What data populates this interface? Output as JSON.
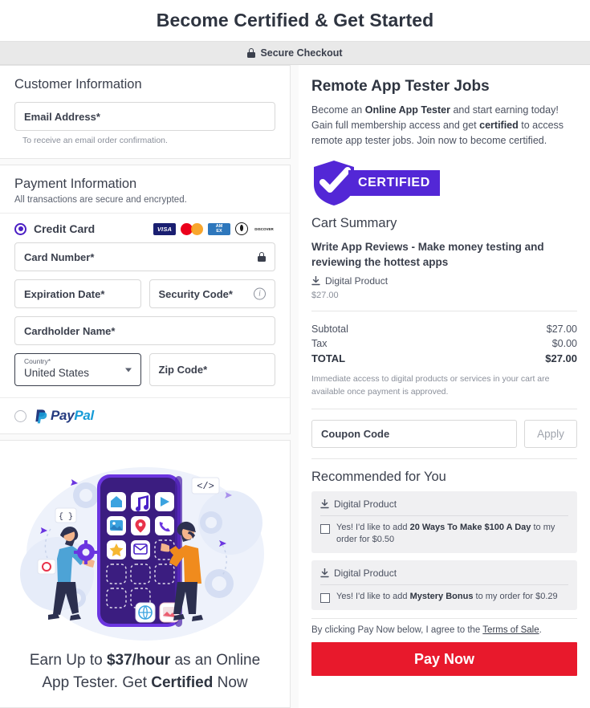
{
  "header": {
    "title": "Become Certified & Get Started",
    "secure_label": "Secure Checkout",
    "lock_icon": "lock-icon"
  },
  "customer": {
    "section_title": "Customer Information",
    "email_placeholder": "Email Address*",
    "email_value": "",
    "email_note": "To receive an email order confirmation."
  },
  "payment": {
    "section_title": "Payment Information",
    "section_subtitle": "All transactions are secure and encrypted.",
    "credit_card_label": "Credit Card",
    "credit_card_selected": true,
    "brands": [
      {
        "name": "visa-logo",
        "text": "VISA"
      },
      {
        "name": "mastercard-logo",
        "text": ""
      },
      {
        "name": "amex-logo",
        "text1": "AM",
        "text2": "EX"
      },
      {
        "name": "diners-club-logo",
        "text": ""
      },
      {
        "name": "discover-logo",
        "text": "DISCOVER"
      }
    ],
    "card_number_placeholder": "Card Number*",
    "card_number_value": "",
    "expiration_placeholder": "Expiration Date*",
    "expiration_value": "",
    "security_code_placeholder": "Security Code*",
    "security_code_value": "",
    "cardholder_placeholder": "Cardholder Name*",
    "cardholder_value": "",
    "country_label": "Country*",
    "country_value": "United States",
    "zip_placeholder": "Zip Code*",
    "zip_value": "",
    "paypal_label": "PayPal",
    "paypal_pay": "Pay",
    "paypal_pal": "Pal",
    "paypal_selected": false
  },
  "promo": {
    "line1_a": "Earn Up to ",
    "line1_b": "$37/hour",
    "line1_c": " as an Online",
    "line2_a": "App Tester. Get ",
    "line2_b": "Certified",
    "line2_c": " Now",
    "illustration": "app-testing-illustration"
  },
  "offer": {
    "title": "Remote App Tester Jobs",
    "desc_1": "Become an ",
    "desc_b1": "Online App Tester",
    "desc_2": " and start earning today! Gain full membership access and get ",
    "desc_b2": "certified",
    "desc_3": " to access remote app tester jobs. Join now to become certified.",
    "badge_text": "CERTIFIED"
  },
  "cart": {
    "title": "Cart Summary",
    "item_name": "Write App Reviews - Make money testing and reviewing the hottest apps",
    "item_type": "Digital Product",
    "item_price": "$27.00",
    "subtotal_label": "Subtotal",
    "subtotal_value": "$27.00",
    "tax_label": "Tax",
    "tax_value": "$0.00",
    "total_label": "TOTAL",
    "total_value": "$27.00",
    "note": "Immediate access to digital products or services in your cart are available once payment is approved."
  },
  "coupon": {
    "placeholder": "Coupon Code",
    "value": "",
    "apply_label": "Apply"
  },
  "recommended": {
    "title": "Recommended for You",
    "items": [
      {
        "type": "Digital Product",
        "text_1": "Yes! I'd like to add ",
        "bold": "20 Ways To Make $100 A Day",
        "text_2": " to my order for $0.50",
        "checked": false
      },
      {
        "type": "Digital Product",
        "text_1": "Yes! I'd like to add ",
        "bold": "Mystery Bonus",
        "text_2": " to my order for $0.29",
        "checked": false
      }
    ]
  },
  "footer": {
    "terms_prefix": "By clicking Pay Now below, I agree to the ",
    "terms_link": "Terms of Sale",
    "terms_suffix": ".",
    "pay_button": "Pay Now"
  },
  "colors": {
    "accent_purple": "#5327d6",
    "pay_red": "#e8192c",
    "text_dark": "#3a3f4c",
    "secure_bar": "#e9e9e9"
  }
}
